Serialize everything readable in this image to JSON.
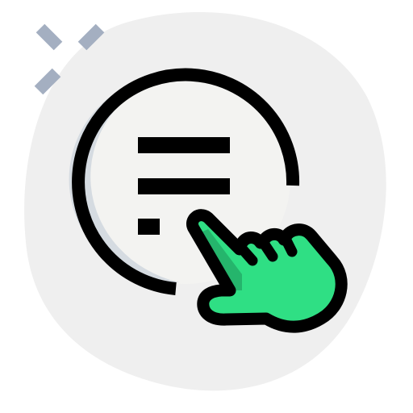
{
  "icon": {
    "name": "tap-menu-icon",
    "colors": {
      "blob": "#efefef",
      "sparkle": "#a4afc1",
      "circle_fill": "#f3f3f1",
      "circle_shadow": "#d5dbe1",
      "stroke": "#000000",
      "hand": "#2fdf84",
      "hand_shadow": "#25b56c"
    },
    "parts": [
      "background-blob",
      "sparkle-lines",
      "menu-circle",
      "menu-lines",
      "pointing-hand-icon"
    ]
  }
}
